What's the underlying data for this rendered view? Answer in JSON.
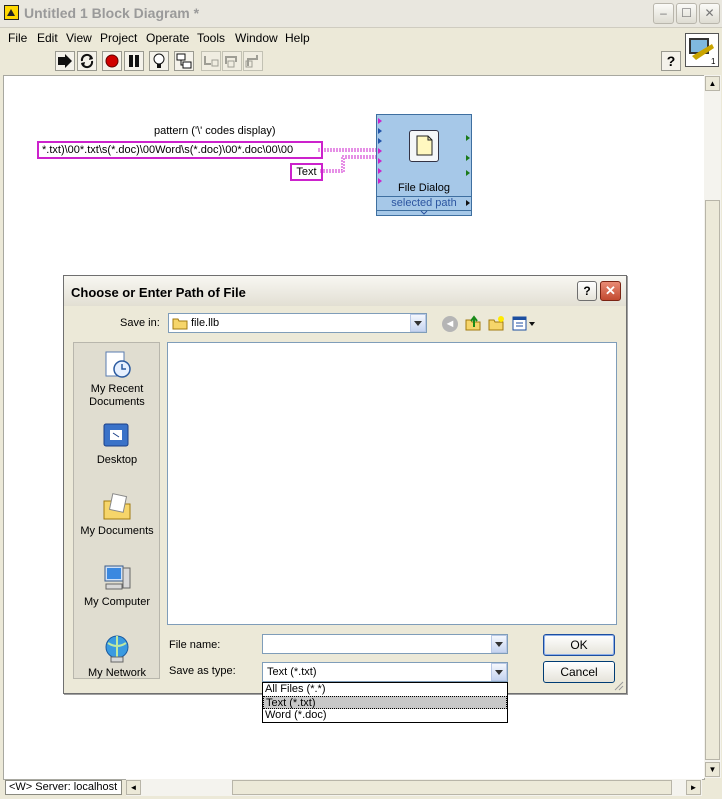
{
  "window": {
    "title": "Untitled 1 Block Diagram *",
    "controls": [
      "–",
      "☐",
      "✕"
    ]
  },
  "menu": [
    "File",
    "Edit",
    "View",
    "Project",
    "Operate",
    "Tools",
    "Window",
    "Help"
  ],
  "diagram": {
    "pattern_label": "pattern ('\\' codes display)",
    "pattern_value": "*.txt)\\00*.txt\\s(*.doc)\\00Word\\s(*.doc)\\00*.doc\\00\\00",
    "text_constant": "Text",
    "node_title": "File Dialog",
    "node_output": "selected path"
  },
  "dialog": {
    "title": "Choose or Enter Path of File",
    "save_in_label": "Save in:",
    "save_in_value": "file.llb",
    "places": [
      "My Recent Documents",
      "Desktop",
      "My Documents",
      "My Computer",
      "My Network"
    ],
    "file_name_label": "File name:",
    "file_name_value": "",
    "save_as_type_label": "Save as type:",
    "save_as_type_value": "Text (*.txt)",
    "type_options": [
      "All Files (*.*)",
      "Text (*.txt)",
      "Word (*.doc)"
    ],
    "selected_option": 1,
    "ok_label": "OK",
    "cancel_label": "Cancel"
  },
  "status": {
    "server": "<W> Server: localhost"
  }
}
